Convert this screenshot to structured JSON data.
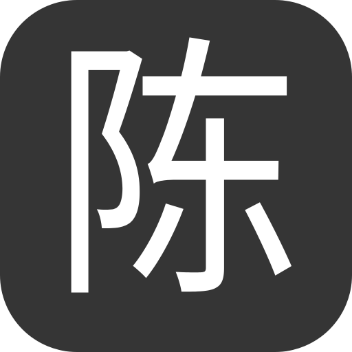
{
  "app_icon": {
    "glyph": "陈",
    "background_color": "#353535",
    "glyph_color": "#ffffff"
  }
}
